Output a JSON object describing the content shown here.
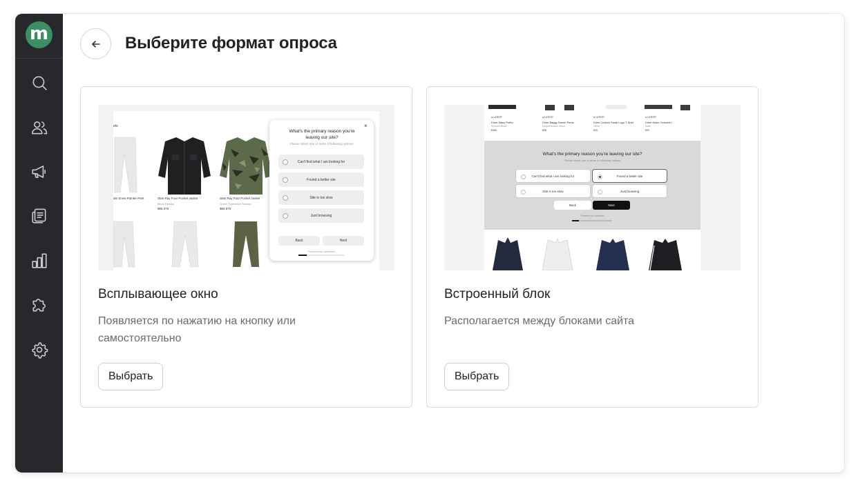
{
  "app": {
    "logo_letter": "m",
    "brand_color": "#3c8f63",
    "sidebar_bg": "#27282c"
  },
  "sidebar": {
    "items": [
      {
        "name": "search-icon"
      },
      {
        "name": "users-icon"
      },
      {
        "name": "megaphone-icon"
      },
      {
        "name": "surveys-icon"
      },
      {
        "name": "analytics-icon"
      },
      {
        "name": "integrations-icon"
      },
      {
        "name": "settings-icon"
      }
    ]
  },
  "header": {
    "back_icon": "arrow-left-icon",
    "title": "Выберите формат опроса"
  },
  "cards": [
    {
      "title": "Всплывающее окно",
      "description": "Появляется по нажатию на кнопку или самостоятельно",
      "button_label": "Выбрать",
      "preview": {
        "question": "What's the primary reason you're leaving our site?",
        "subtitle": "Please select one or more of following options",
        "options": [
          "Can't find what I am looking for",
          "Found a better site",
          "Site is too slow",
          "Just browsing"
        ],
        "back_label": "Back",
        "next_label": "Next",
        "powered": "Powered by Unisdbox",
        "close_glyph": "×",
        "products": [
          {
            "name": "Stan Ray Four Pocket Jacket",
            "subtitle": "Black Ripstop",
            "price": "$65,075"
          },
          {
            "name": "Stan Ray Four Pocket Jacket",
            "subtitle": "Green Tigerstripe Ripstop",
            "price": "$65,075"
          }
        ],
        "left_product": "ale Snow Painter Pant",
        "edge_text": "ets"
      }
    },
    {
      "title": "Встроенный блок",
      "description": "Располагается между блоками сайта",
      "button_label": "Выбрать",
      "preview": {
        "question": "What's the primary reason you're leaving our site?",
        "subtitle": "Please select one or more of following options",
        "options": [
          "Can't find what I am looking for",
          "Found a better site",
          "Site is too slow",
          "Just browsing"
        ],
        "back_label": "Back",
        "next_label": "Next",
        "powered": "Powered by Unisdbox",
        "products": [
          {
            "tag": "● LATEST",
            "name": "Dime Wavy Puffer",
            "subtitle": "Smoked Black",
            "price": "€265"
          },
          {
            "tag": "● LATEST",
            "name": "Dime Baggy Denim Pants",
            "subtitle": "Indigo/medium Wash",
            "price": "€98"
          },
          {
            "tag": "● LATEST",
            "name": "Dime Cursive Small Logo T-Shirt",
            "subtitle": "White",
            "price": "€39"
          },
          {
            "tag": "● LATEST",
            "name": "Dime Wave Overshirt",
            "subtitle": "Slate",
            "price": "€92"
          }
        ]
      }
    }
  ]
}
